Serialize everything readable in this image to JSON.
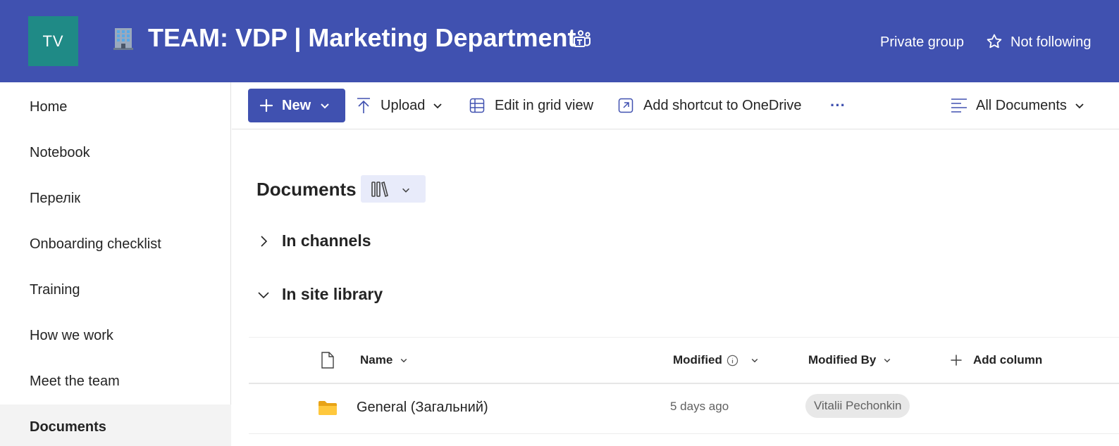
{
  "header": {
    "logo_initials": "TV",
    "title": "TEAM: VDP | Marketing Department",
    "privacy": "Private group",
    "follow_label": "Not following",
    "colors": {
      "header_bg": "#4051b0",
      "logo_bg": "#1f8a86"
    },
    "icons": [
      "office-building-icon",
      "teams-icon",
      "star-icon"
    ]
  },
  "sidebar": {
    "items": [
      {
        "label": "Home"
      },
      {
        "label": "Notebook"
      },
      {
        "label": "Перелік"
      },
      {
        "label": "Onboarding checklist"
      },
      {
        "label": "Training"
      },
      {
        "label": "How we work"
      },
      {
        "label": "Meet the team"
      },
      {
        "label": "Documents",
        "active": true
      }
    ]
  },
  "toolbar": {
    "new_label": "New",
    "upload_label": "Upload",
    "grid_label": "Edit in grid view",
    "shortcut_label": "Add shortcut to OneDrive",
    "more_label": "···",
    "view_label": "All Documents"
  },
  "library": {
    "title": "Documents",
    "sections": [
      {
        "label": "In channels",
        "expanded": false
      },
      {
        "label": "In site library",
        "expanded": true
      }
    ]
  },
  "table": {
    "columns": {
      "name": "Name",
      "modified": "Modified",
      "modified_by": "Modified By",
      "add_column": "Add column"
    },
    "rows": [
      {
        "name": "General (Загальний)",
        "modified": "5 days ago",
        "modified_by": "Vitalii Pechonkin",
        "type": "folder"
      }
    ]
  }
}
